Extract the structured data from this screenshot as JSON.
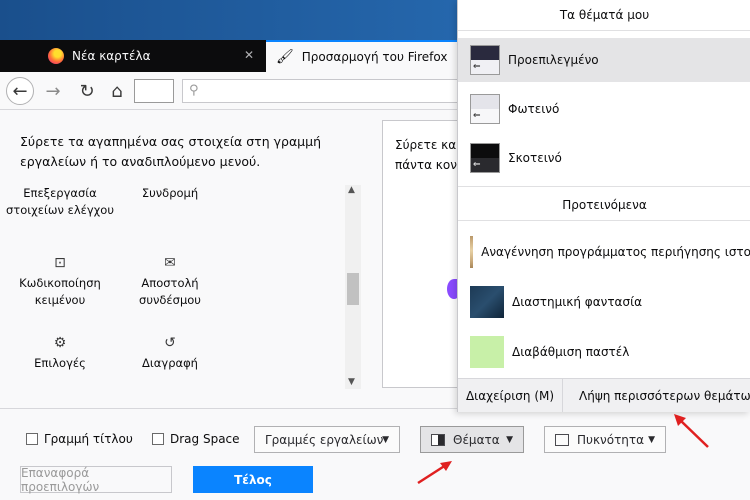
{
  "tabs": [
    {
      "label": "Νέα καρτέλα",
      "icon": "firefox-icon"
    },
    {
      "label": "Προσαρμογή του Firefox",
      "icon": "brush-icon"
    }
  ],
  "palette": {
    "instructions": "Σύρετε τα αγαπημένα σας στοιχεία στη γραμμή εργαλείων ή το αναδιπλούμενο μενού.",
    "items": [
      {
        "label": "Επεξεργασία στοιχείων ελέγχου",
        "icon": ""
      },
      {
        "label": "Συνδρομή",
        "icon": ""
      },
      {
        "label": "Κωδικοποίηση κειμένου",
        "icon": "encoding-icon"
      },
      {
        "label": "Αποστολή συνδέσμου",
        "icon": "mail-icon"
      },
      {
        "label": "Επιλογές",
        "icon": "gear-icon"
      },
      {
        "label": "Διαγραφή",
        "icon": "history-icon"
      }
    ]
  },
  "overflow": {
    "line1": "Σύρετε και",
    "line2": "πάντα κον"
  },
  "bottom": {
    "titlebar_label": "Γραμμή τίτλου",
    "dragspace_label": "Drag Space",
    "toolbars_label": "Γραμμές εργαλείων",
    "themes_label": "Θέματα",
    "density_label": "Πυκνότητα",
    "restore_label": "Επαναφορά προεπιλογών",
    "done_label": "Τέλος"
  },
  "themes_panel": {
    "my_themes_header": "Τα θέματά μου",
    "themes": [
      {
        "label": "Προεπιλεγμένο",
        "selected": true
      },
      {
        "label": "Φωτεινό",
        "selected": false
      },
      {
        "label": "Σκοτεινό",
        "selected": false
      }
    ],
    "recommended_header": "Προτεινόμενα",
    "recommended": [
      {
        "label": "Αναγέννηση προγράμματος περιήγησης ιστο",
        "color": "#c9a97a"
      },
      {
        "label": "Διαστημική φαντασία",
        "color": "#2a4e6e"
      },
      {
        "label": "Διαβάθμιση παστέλ",
        "color": "#c8f0a8"
      }
    ],
    "manage_label": "Διαχείριση (Μ)",
    "more_label": "Λήψη περισσότερων θεμάτων (Λ"
  },
  "colors": {
    "accent": "#0a84ff",
    "arrow": "#e02020"
  }
}
